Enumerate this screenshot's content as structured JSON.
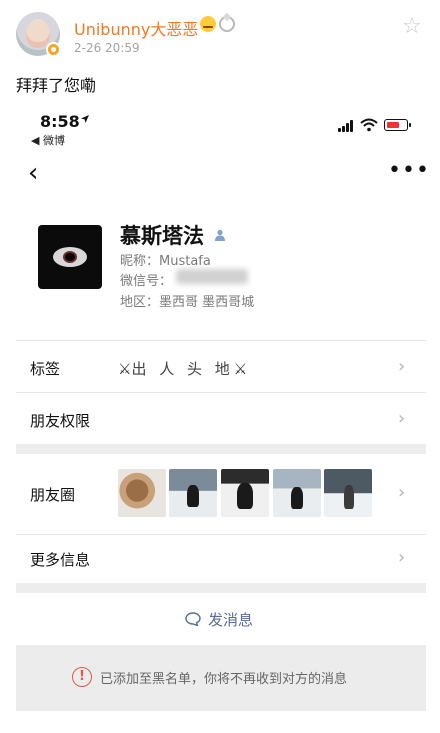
{
  "post": {
    "username": "Unibunny大恶恶",
    "timestamp": "2-26 20:59",
    "text": "拜拜了您嘞",
    "icons": [
      "avatar",
      "verified-badge-icon",
      "emoji-icon",
      "diamond-icon",
      "star-icon"
    ]
  },
  "phone": {
    "time": "8:58",
    "back_app": "◀ 微博",
    "battery_color": "#e33333"
  },
  "profile": {
    "name": "慕斯塔法",
    "nickname": "昵称：Mustafa",
    "wechat_id_label": "微信号：",
    "region": "地区：墨西哥  墨西哥城"
  },
  "rows": {
    "tags_label": "标签",
    "tags_value": "出 人 头 地",
    "permissions_label": "朋友权限",
    "moments_label": "朋友圈",
    "more_info_label": "更多信息"
  },
  "actions": {
    "send_message": "发消息"
  },
  "banner": {
    "text": "已添加至黑名单，你将不再收到对方的消息",
    "warning_color": "#e05a47"
  },
  "colors": {
    "username_orange": "#f07a22",
    "link_blue": "#576b95"
  }
}
